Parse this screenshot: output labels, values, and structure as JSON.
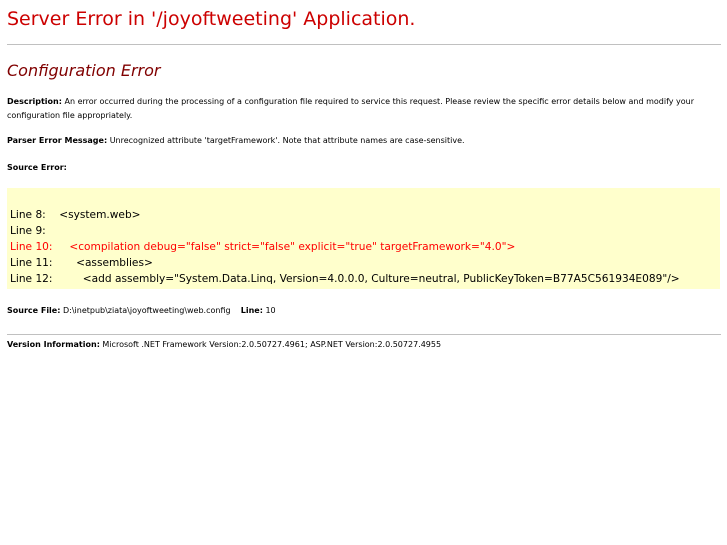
{
  "title": "Server Error in '/joyoftweeting' Application.",
  "subtitle": "Configuration Error",
  "description": {
    "label": "Description:",
    "text": " An error occurred during the processing of a configuration file required to service this request. Please review the specific error details below and modify your configuration file appropriately."
  },
  "parser_error": {
    "label": "Parser Error Message:",
    "text": " Unrecognized attribute 'targetFramework'. Note that attribute names are case-sensitive."
  },
  "source_error": {
    "label": "Source Error:",
    "lines": [
      {
        "text": "Line 8:    <system.web>",
        "is_error": false
      },
      {
        "text": "Line 9:",
        "is_error": false
      },
      {
        "text": "Line 10:     <compilation debug=\"false\" strict=\"false\" explicit=\"true\" targetFramework=\"4.0\">",
        "is_error": true
      },
      {
        "text": "Line 11:       <assemblies>",
        "is_error": false
      },
      {
        "text": "Line 12:         <add assembly=\"System.Data.Linq, Version=4.0.0.0, Culture=neutral, PublicKeyToken=B77A5C561934E089\"/>",
        "is_error": false
      }
    ]
  },
  "source_file": {
    "label": "Source File:",
    "path": " D:\\inetpub\\ziata\\joyoftweeting\\web.config",
    "line_label": "Line:",
    "line_value": " 10"
  },
  "version_info": {
    "label": "Version Information:",
    "text": " Microsoft .NET Framework Version:2.0.50727.4961; ASP.NET Version:2.0.50727.4955"
  },
  "colors": {
    "title": "#cc0000",
    "subtitle": "#800000",
    "error_line": "#ff0000",
    "code_background": "#ffffcc",
    "rule": "#c0c0c0"
  }
}
